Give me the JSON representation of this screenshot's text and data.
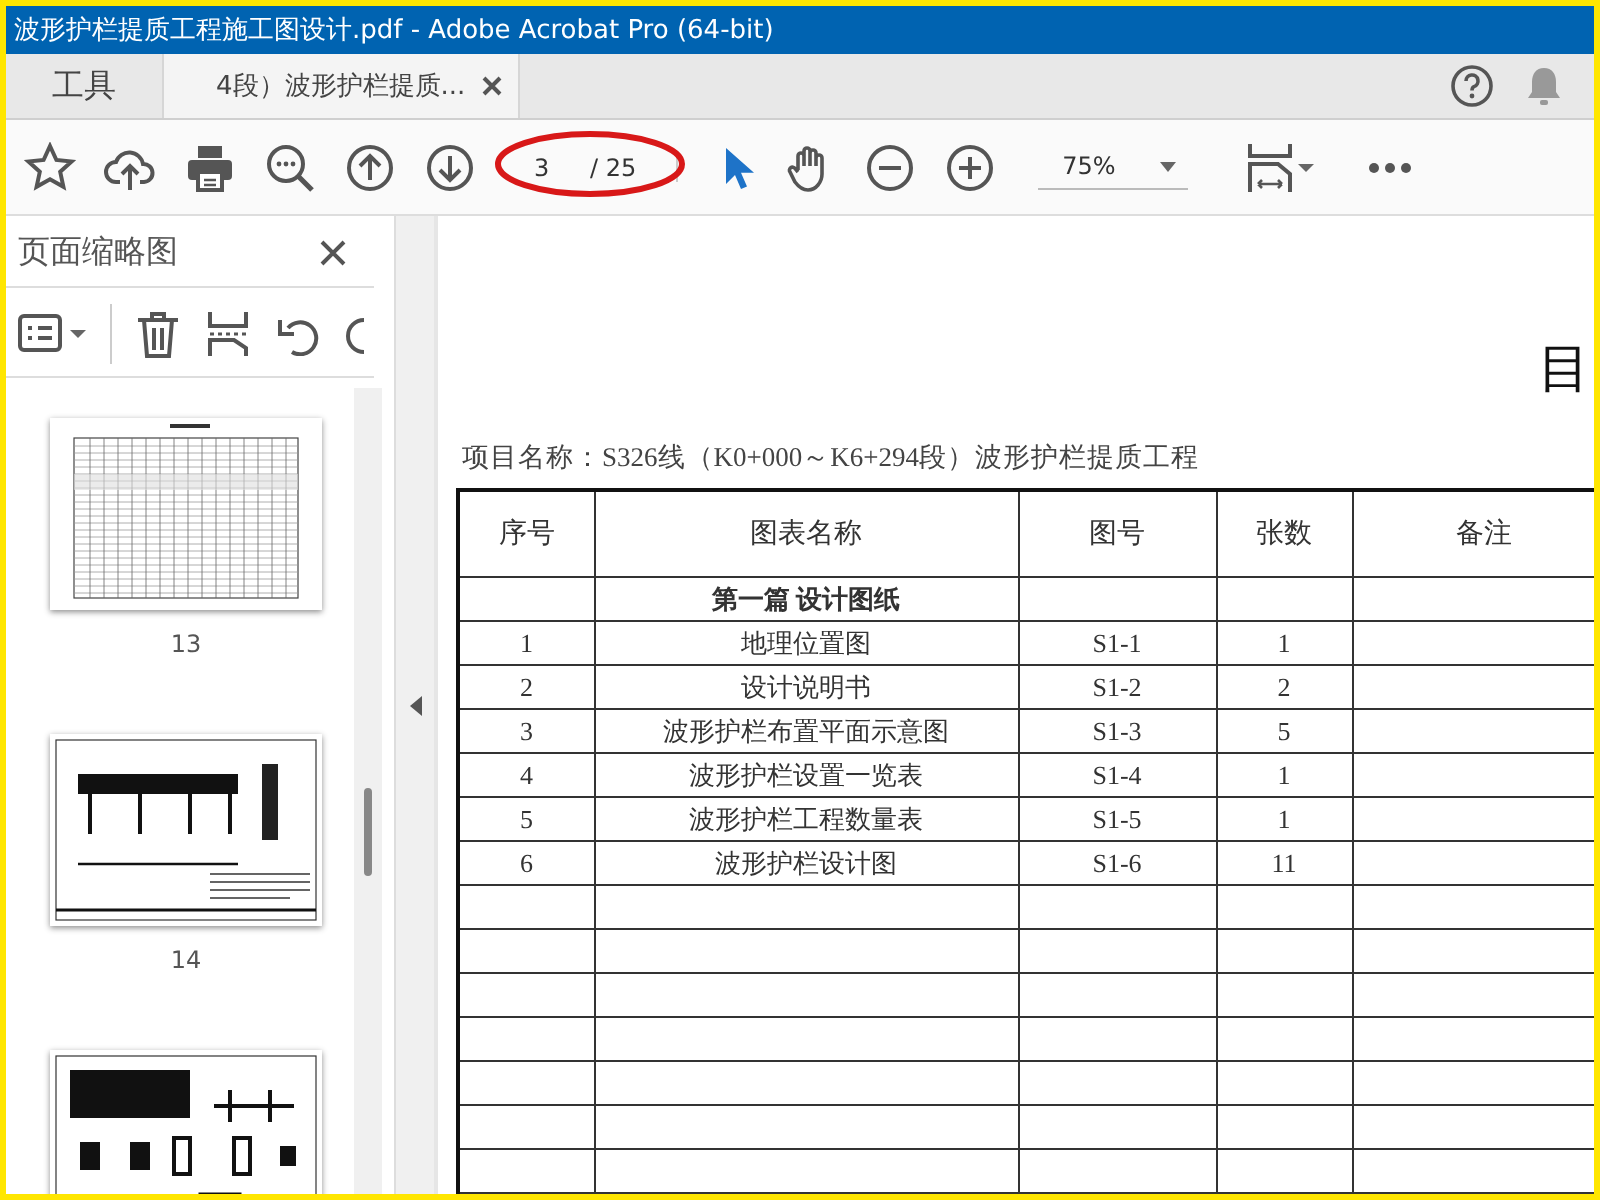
{
  "window": {
    "title": "波形护栏提质工程施工图设计.pdf - Adobe Acrobat Pro (64-bit)"
  },
  "tabs": [
    {
      "label": "工具",
      "selected": false
    },
    {
      "label": "4段）波形护栏提质...",
      "selected": true
    }
  ],
  "toolbar": {
    "page_field": {
      "value": "3",
      "total": "/ 25"
    },
    "zoom": {
      "value": "75%"
    }
  },
  "sidebar": {
    "title": "页面缩略图",
    "thumbnails": [
      {
        "kind": "table",
        "label": "13"
      },
      {
        "kind": "plan",
        "label": "14"
      },
      {
        "kind": "details"
      }
    ]
  },
  "document": {
    "heading": "目",
    "project": "项目名称：S326线（K0+000～K6+294段）波形护栏提质工程",
    "table": {
      "columns": [
        "序号",
        "图表名称",
        "图号",
        "张数",
        "备注"
      ],
      "rows": [
        {
          "kind": "section",
          "title": "第一篇 设计图纸"
        },
        {
          "kind": "item",
          "cells": [
            "1",
            "地理位置图",
            "S1-1",
            "1"
          ]
        },
        {
          "kind": "item",
          "cells": [
            "2",
            "设计说明书",
            "S1-2",
            "2"
          ]
        },
        {
          "kind": "item",
          "cells": [
            "3",
            "波形护栏布置平面示意图",
            "S1-3",
            "5"
          ]
        },
        {
          "kind": "item",
          "cells": [
            "4",
            "波形护栏设置一览表",
            "S1-4",
            "1"
          ]
        },
        {
          "kind": "item",
          "cells": [
            "5",
            "波形护栏工程数量表",
            "S1-5",
            "1"
          ]
        },
        {
          "kind": "item",
          "cells": [
            "6",
            "波形护栏设计图",
            "S1-6",
            "11"
          ]
        }
      ]
    }
  }
}
